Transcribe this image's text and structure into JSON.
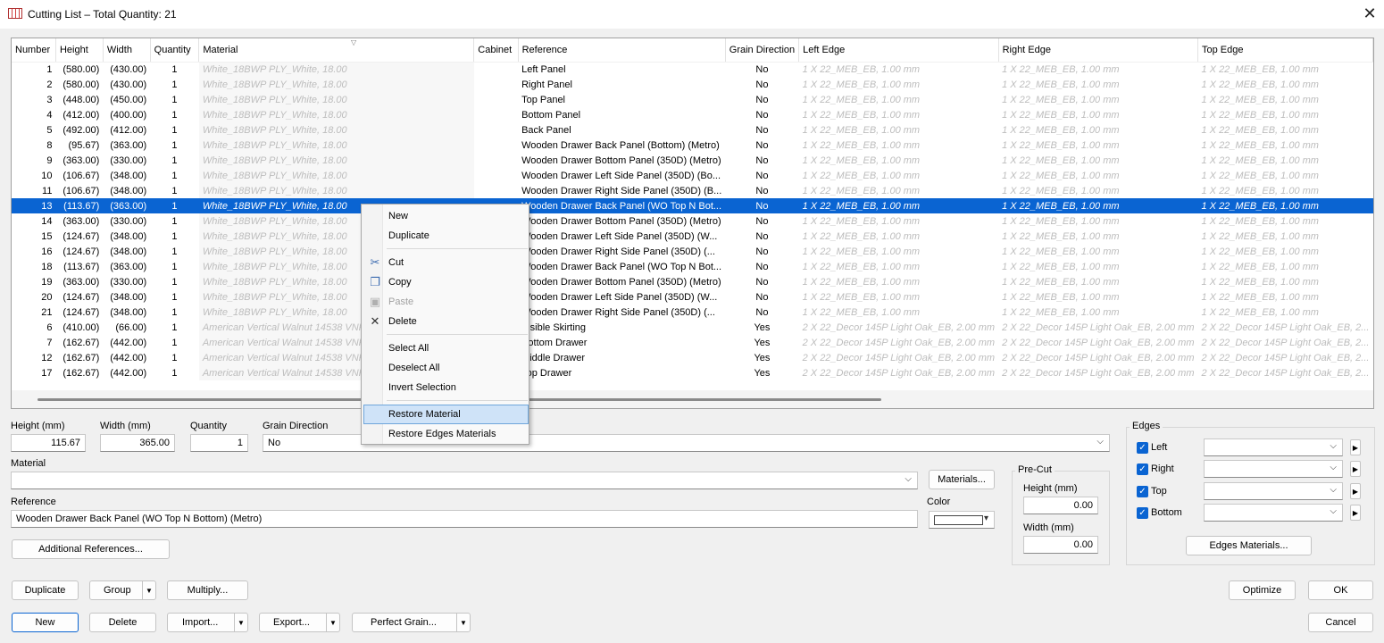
{
  "window": {
    "title": "Cutting List – Total Quantity: 21"
  },
  "grid": {
    "columns": [
      "Number",
      "Height",
      "Width",
      "Quantity",
      "Material",
      "Cabinet",
      "Reference",
      "Grain Direction",
      "Left Edge",
      "Right Edge",
      "Top Edge"
    ],
    "rows": [
      {
        "num": "1",
        "h": "(580.00)",
        "w": "(430.00)",
        "q": "1",
        "mat": "White_18BWP PLY_White, 18.00",
        "cab": "",
        "ref": "Left Panel",
        "grain": "No",
        "le": "1 X 22_MEB_EB, 1.00 mm",
        "re": "1 X 22_MEB_EB, 1.00 mm",
        "te": "1 X 22_MEB_EB, 1.00 mm"
      },
      {
        "num": "2",
        "h": "(580.00)",
        "w": "(430.00)",
        "q": "1",
        "mat": "White_18BWP PLY_White, 18.00",
        "cab": "",
        "ref": "Right Panel",
        "grain": "No",
        "le": "1 X 22_MEB_EB, 1.00 mm",
        "re": "1 X 22_MEB_EB, 1.00 mm",
        "te": "1 X 22_MEB_EB, 1.00 mm"
      },
      {
        "num": "3",
        "h": "(448.00)",
        "w": "(450.00)",
        "q": "1",
        "mat": "White_18BWP PLY_White, 18.00",
        "cab": "",
        "ref": "Top Panel",
        "grain": "No",
        "le": "1 X 22_MEB_EB, 1.00 mm",
        "re": "1 X 22_MEB_EB, 1.00 mm",
        "te": "1 X 22_MEB_EB, 1.00 mm"
      },
      {
        "num": "4",
        "h": "(412.00)",
        "w": "(400.00)",
        "q": "1",
        "mat": "White_18BWP PLY_White, 18.00",
        "cab": "",
        "ref": "Bottom Panel",
        "grain": "No",
        "le": "1 X 22_MEB_EB, 1.00 mm",
        "re": "1 X 22_MEB_EB, 1.00 mm",
        "te": "1 X 22_MEB_EB, 1.00 mm"
      },
      {
        "num": "5",
        "h": "(492.00)",
        "w": "(412.00)",
        "q": "1",
        "mat": "White_18BWP PLY_White, 18.00",
        "cab": "",
        "ref": "Back Panel",
        "grain": "No",
        "le": "1 X 22_MEB_EB, 1.00 mm",
        "re": "1 X 22_MEB_EB, 1.00 mm",
        "te": "1 X 22_MEB_EB, 1.00 mm"
      },
      {
        "num": "8",
        "h": "(95.67)",
        "w": "(363.00)",
        "q": "1",
        "mat": "White_18BWP PLY_White, 18.00",
        "cab": "",
        "ref": "Wooden Drawer Back Panel (Bottom) (Metro)",
        "grain": "No",
        "le": "1 X 22_MEB_EB, 1.00 mm",
        "re": "1 X 22_MEB_EB, 1.00 mm",
        "te": "1 X 22_MEB_EB, 1.00 mm"
      },
      {
        "num": "9",
        "h": "(363.00)",
        "w": "(330.00)",
        "q": "1",
        "mat": "White_18BWP PLY_White, 18.00",
        "cab": "",
        "ref": "Wooden Drawer Bottom Panel (350D) (Metro)",
        "grain": "No",
        "le": "1 X 22_MEB_EB, 1.00 mm",
        "re": "1 X 22_MEB_EB, 1.00 mm",
        "te": "1 X 22_MEB_EB, 1.00 mm"
      },
      {
        "num": "10",
        "h": "(106.67)",
        "w": "(348.00)",
        "q": "1",
        "mat": "White_18BWP PLY_White, 18.00",
        "cab": "",
        "ref": "Wooden Drawer Left Side Panel (350D) (Bo...",
        "grain": "No",
        "le": "1 X 22_MEB_EB, 1.00 mm",
        "re": "1 X 22_MEB_EB, 1.00 mm",
        "te": "1 X 22_MEB_EB, 1.00 mm"
      },
      {
        "num": "11",
        "h": "(106.67)",
        "w": "(348.00)",
        "q": "1",
        "mat": "White_18BWP PLY_White, 18.00",
        "cab": "",
        "ref": "Wooden Drawer Right Side Panel (350D) (B...",
        "grain": "No",
        "le": "1 X 22_MEB_EB, 1.00 mm",
        "re": "1 X 22_MEB_EB, 1.00 mm",
        "te": "1 X 22_MEB_EB, 1.00 mm"
      },
      {
        "num": "13",
        "h": "(113.67)",
        "w": "(363.00)",
        "q": "1",
        "mat": "White_18BWP PLY_White, 18.00",
        "cab": "",
        "ref": "Wooden Drawer Back Panel (WO Top N Bot...",
        "grain": "No",
        "le": "1 X 22_MEB_EB, 1.00 mm",
        "re": "1 X 22_MEB_EB, 1.00 mm",
        "te": "1 X 22_MEB_EB, 1.00 mm",
        "selected": true
      },
      {
        "num": "14",
        "h": "(363.00)",
        "w": "(330.00)",
        "q": "1",
        "mat": "White_18BWP PLY_White, 18.00",
        "cab": "",
        "ref": "Wooden Drawer Bottom Panel (350D) (Metro)",
        "grain": "No",
        "le": "1 X 22_MEB_EB, 1.00 mm",
        "re": "1 X 22_MEB_EB, 1.00 mm",
        "te": "1 X 22_MEB_EB, 1.00 mm"
      },
      {
        "num": "15",
        "h": "(124.67)",
        "w": "(348.00)",
        "q": "1",
        "mat": "White_18BWP PLY_White, 18.00",
        "cab": "",
        "ref": "Wooden Drawer Left Side Panel (350D) (W...",
        "grain": "No",
        "le": "1 X 22_MEB_EB, 1.00 mm",
        "re": "1 X 22_MEB_EB, 1.00 mm",
        "te": "1 X 22_MEB_EB, 1.00 mm"
      },
      {
        "num": "16",
        "h": "(124.67)",
        "w": "(348.00)",
        "q": "1",
        "mat": "White_18BWP PLY_White, 18.00",
        "cab": "",
        "ref": "Wooden Drawer Right Side Panel (350D) (...",
        "grain": "No",
        "le": "1 X 22_MEB_EB, 1.00 mm",
        "re": "1 X 22_MEB_EB, 1.00 mm",
        "te": "1 X 22_MEB_EB, 1.00 mm"
      },
      {
        "num": "18",
        "h": "(113.67)",
        "w": "(363.00)",
        "q": "1",
        "mat": "White_18BWP PLY_White, 18.00",
        "cab": "",
        "ref": "Wooden Drawer Back Panel (WO Top N Bot...",
        "grain": "No",
        "le": "1 X 22_MEB_EB, 1.00 mm",
        "re": "1 X 22_MEB_EB, 1.00 mm",
        "te": "1 X 22_MEB_EB, 1.00 mm"
      },
      {
        "num": "19",
        "h": "(363.00)",
        "w": "(330.00)",
        "q": "1",
        "mat": "White_18BWP PLY_White, 18.00",
        "cab": "",
        "ref": "Wooden Drawer Bottom Panel (350D) (Metro)",
        "grain": "No",
        "le": "1 X 22_MEB_EB, 1.00 mm",
        "re": "1 X 22_MEB_EB, 1.00 mm",
        "te": "1 X 22_MEB_EB, 1.00 mm"
      },
      {
        "num": "20",
        "h": "(124.67)",
        "w": "(348.00)",
        "q": "1",
        "mat": "White_18BWP PLY_White, 18.00",
        "cab": "",
        "ref": "Wooden Drawer Left Side Panel (350D) (W...",
        "grain": "No",
        "le": "1 X 22_MEB_EB, 1.00 mm",
        "re": "1 X 22_MEB_EB, 1.00 mm",
        "te": "1 X 22_MEB_EB, 1.00 mm"
      },
      {
        "num": "21",
        "h": "(124.67)",
        "w": "(348.00)",
        "q": "1",
        "mat": "White_18BWP PLY_White, 18.00",
        "cab": "",
        "ref": "Wooden Drawer Right Side Panel (350D) (...",
        "grain": "No",
        "le": "1 X 22_MEB_EB, 1.00 mm",
        "re": "1 X 22_MEB_EB, 1.00 mm",
        "te": "1 X 22_MEB_EB, 1.00 mm"
      },
      {
        "num": "6",
        "h": "(410.00)",
        "w": "(66.00)",
        "q": "1",
        "mat": "American Vertical Walnut 14538 VNR",
        "cab": "",
        "ref": "Visible Skirting",
        "grain": "Yes",
        "le": "2 X 22_Decor 145P Light Oak_EB, 2.00 mm",
        "re": "2 X 22_Decor 145P Light Oak_EB, 2.00 mm",
        "te": "2 X 22_Decor 145P Light Oak_EB, 2..."
      },
      {
        "num": "7",
        "h": "(162.67)",
        "w": "(442.00)",
        "q": "1",
        "mat": "American Vertical Walnut 14538 VNR",
        "cab": "",
        "ref": "Bottom Drawer",
        "grain": "Yes",
        "le": "2 X 22_Decor 145P Light Oak_EB, 2.00 mm",
        "re": "2 X 22_Decor 145P Light Oak_EB, 2.00 mm",
        "te": "2 X 22_Decor 145P Light Oak_EB, 2..."
      },
      {
        "num": "12",
        "h": "(162.67)",
        "w": "(442.00)",
        "q": "1",
        "mat": "American Vertical Walnut 14538 VNR",
        "cab": "",
        "ref": "Middle Drawer",
        "grain": "Yes",
        "le": "2 X 22_Decor 145P Light Oak_EB, 2.00 mm",
        "re": "2 X 22_Decor 145P Light Oak_EB, 2.00 mm",
        "te": "2 X 22_Decor 145P Light Oak_EB, 2..."
      },
      {
        "num": "17",
        "h": "(162.67)",
        "w": "(442.00)",
        "q": "1",
        "mat": "American Vertical Walnut 14538 VNR",
        "cab": "",
        "ref": "Top Drawer",
        "grain": "Yes",
        "le": "2 X 22_Decor 145P Light Oak_EB, 2.00 mm",
        "re": "2 X 22_Decor 145P Light Oak_EB, 2.00 mm",
        "te": "2 X 22_Decor 145P Light Oak_EB, 2..."
      }
    ]
  },
  "form": {
    "height_label": "Height (mm)",
    "height_value": "115.67",
    "width_label": "Width (mm)",
    "width_value": "365.00",
    "quantity_label": "Quantity",
    "quantity_value": "1",
    "grain_label": "Grain Direction",
    "grain_value": "No",
    "material_label": "Material",
    "material_value": "",
    "materials_button": "Materials...",
    "reference_label": "Reference",
    "reference_value": "Wooden Drawer Back Panel (WO Top N Bottom) (Metro)",
    "color_label": "Color",
    "additional_refs_button": "Additional References...",
    "precut_title": "Pre-Cut",
    "precut_height_label": "Height (mm)",
    "precut_height_value": "0.00",
    "precut_width_label": "Width (mm)",
    "precut_width_value": "0.00"
  },
  "edges": {
    "title": "Edges",
    "left": "Left",
    "right": "Right",
    "top": "Top",
    "bottom": "Bottom",
    "materials_button": "Edges Materials..."
  },
  "buttons": {
    "duplicate": "Duplicate",
    "group": "Group",
    "multiply": "Multiply...",
    "new": "New",
    "delete": "Delete",
    "import": "Import...",
    "export": "Export...",
    "perfect_grain": "Perfect Grain...",
    "optimize": "Optimize",
    "ok": "OK",
    "cancel": "Cancel"
  },
  "context_menu": {
    "new": "New",
    "duplicate": "Duplicate",
    "cut": "Cut",
    "copy": "Copy",
    "paste": "Paste",
    "delete": "Delete",
    "select_all": "Select All",
    "deselect_all": "Deselect All",
    "invert_selection": "Invert Selection",
    "restore_material": "Restore Material",
    "restore_edges_materials": "Restore Edges Materials"
  },
  "colors": {
    "selection": "#0a64d2",
    "menu_highlight": "#cfe3f8"
  }
}
